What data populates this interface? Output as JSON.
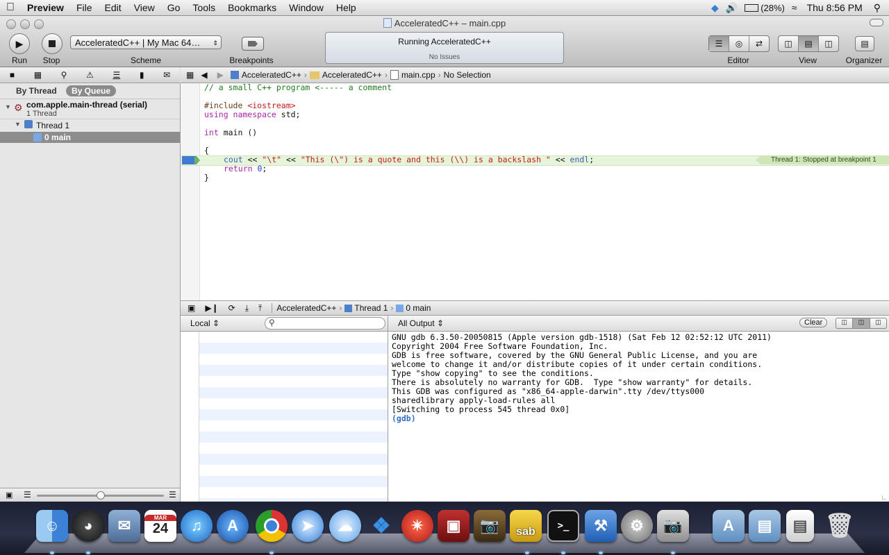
{
  "menubar": {
    "app": "Preview",
    "items": [
      "File",
      "Edit",
      "View",
      "Go",
      "Tools",
      "Bookmarks",
      "Window",
      "Help"
    ],
    "battery": "(28%)",
    "clock": "Thu 8:56 PM"
  },
  "window": {
    "title": "AcceleratedC++ – main.cpp"
  },
  "toolbar": {
    "run_label": "Run",
    "stop_label": "Stop",
    "scheme_value": "AcceleratedC++ | My Mac 64…",
    "scheme_label": "Scheme",
    "breakpoints_label": "Breakpoints",
    "activity_title": "Running AcceleratedC++",
    "activity_status": "No Issues",
    "editor_label": "Editor",
    "view_label": "View",
    "organizer_label": "Organizer"
  },
  "navigator": {
    "tab_thread": "By Thread",
    "tab_queue": "By Queue",
    "queue_name": "com.apple.main-thread (serial)",
    "queue_count": "1 Thread",
    "thread": "Thread 1",
    "frame": "0 main"
  },
  "jumpbar": {
    "project": "AcceleratedC++",
    "group": "AcceleratedC++",
    "file": "main.cpp",
    "selection": "No Selection"
  },
  "editor": {
    "comment": "// a small C++ program <----- a comment",
    "include_kw": "#include",
    "include_hdr": "<iostream>",
    "using_kw": "using namespace",
    "using_rest": " std;",
    "int_kw": "int",
    "main_decl": " main ()",
    "open_brace": "{",
    "cout_ident": "cout",
    "op1": " << ",
    "str_tab": "\"\\t\"",
    "op2": " << ",
    "str_msg": "\"This (\\\") is a quote and this (\\\\) is a backslash \"",
    "op3": " << ",
    "endl_ident": "endl",
    "semi": ";",
    "return_kw": "return",
    "return_val": "0",
    "return_semi": ";",
    "close_brace": "}",
    "breakpoint_annotation": "Thread 1: Stopped at breakpoint 1"
  },
  "debugbar": {
    "project": "AcceleratedC++",
    "thread": "Thread 1",
    "frame": "0 main"
  },
  "variables": {
    "scope": "Local ⇕",
    "search_placeholder": ""
  },
  "console": {
    "filter": "All Output ⇕",
    "clear_label": "Clear",
    "lines": [
      "GNU gdb 6.3.50-20050815 (Apple version gdb-1518) (Sat Feb 12 02:52:12 UTC 2011)",
      "Copyright 2004 Free Software Foundation, Inc.",
      "GDB is free software, covered by the GNU General Public License, and you are",
      "welcome to change it and/or distribute copies of it under certain conditions.",
      "Type \"show copying\" to see the conditions.",
      "There is absolutely no warranty for GDB.  Type \"show warranty\" for details.",
      "This GDB was configured as \"x86_64-apple-darwin\".tty /dev/ttys000",
      "sharedlibrary apply-load-rules all",
      "[Switching to process 545 thread 0x0]"
    ],
    "prompt": "(gdb)"
  },
  "dock": {
    "calendar_month": "MAR",
    "calendar_day": "24",
    "sab_label": "sab"
  },
  "colors": {
    "comment": "#1f7d1f",
    "keyword": "#a626a4",
    "string": "#c41a16",
    "preprocessor": "#6b3b1a",
    "identifier": "#3b5fb0",
    "current_line": "#e8f5dc",
    "gdb_prompt": "#2f6ec9"
  }
}
